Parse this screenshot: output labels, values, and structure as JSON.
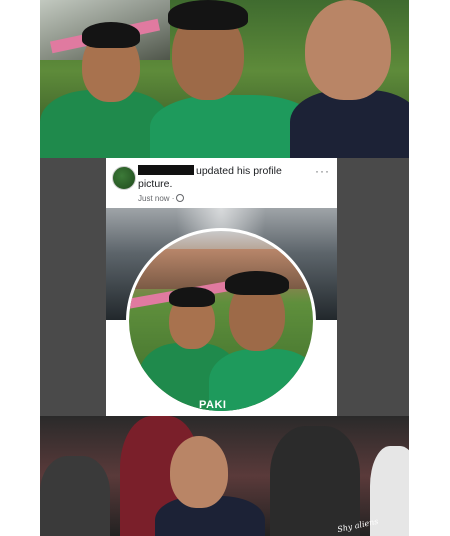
{
  "post": {
    "name_suffix": "updated his profile picture.",
    "timestamp": "Just now",
    "more_label": "···"
  },
  "profile_photo": {
    "shirt_text": "PAKI"
  },
  "bottom_photo": {
    "watermark": "Shy aliens"
  },
  "colors": {
    "dark_band": "#4a4a4a",
    "pakistan_green": "#1f8a4c",
    "facebook_text": "#1c1e21",
    "muted_text": "#65676b"
  }
}
